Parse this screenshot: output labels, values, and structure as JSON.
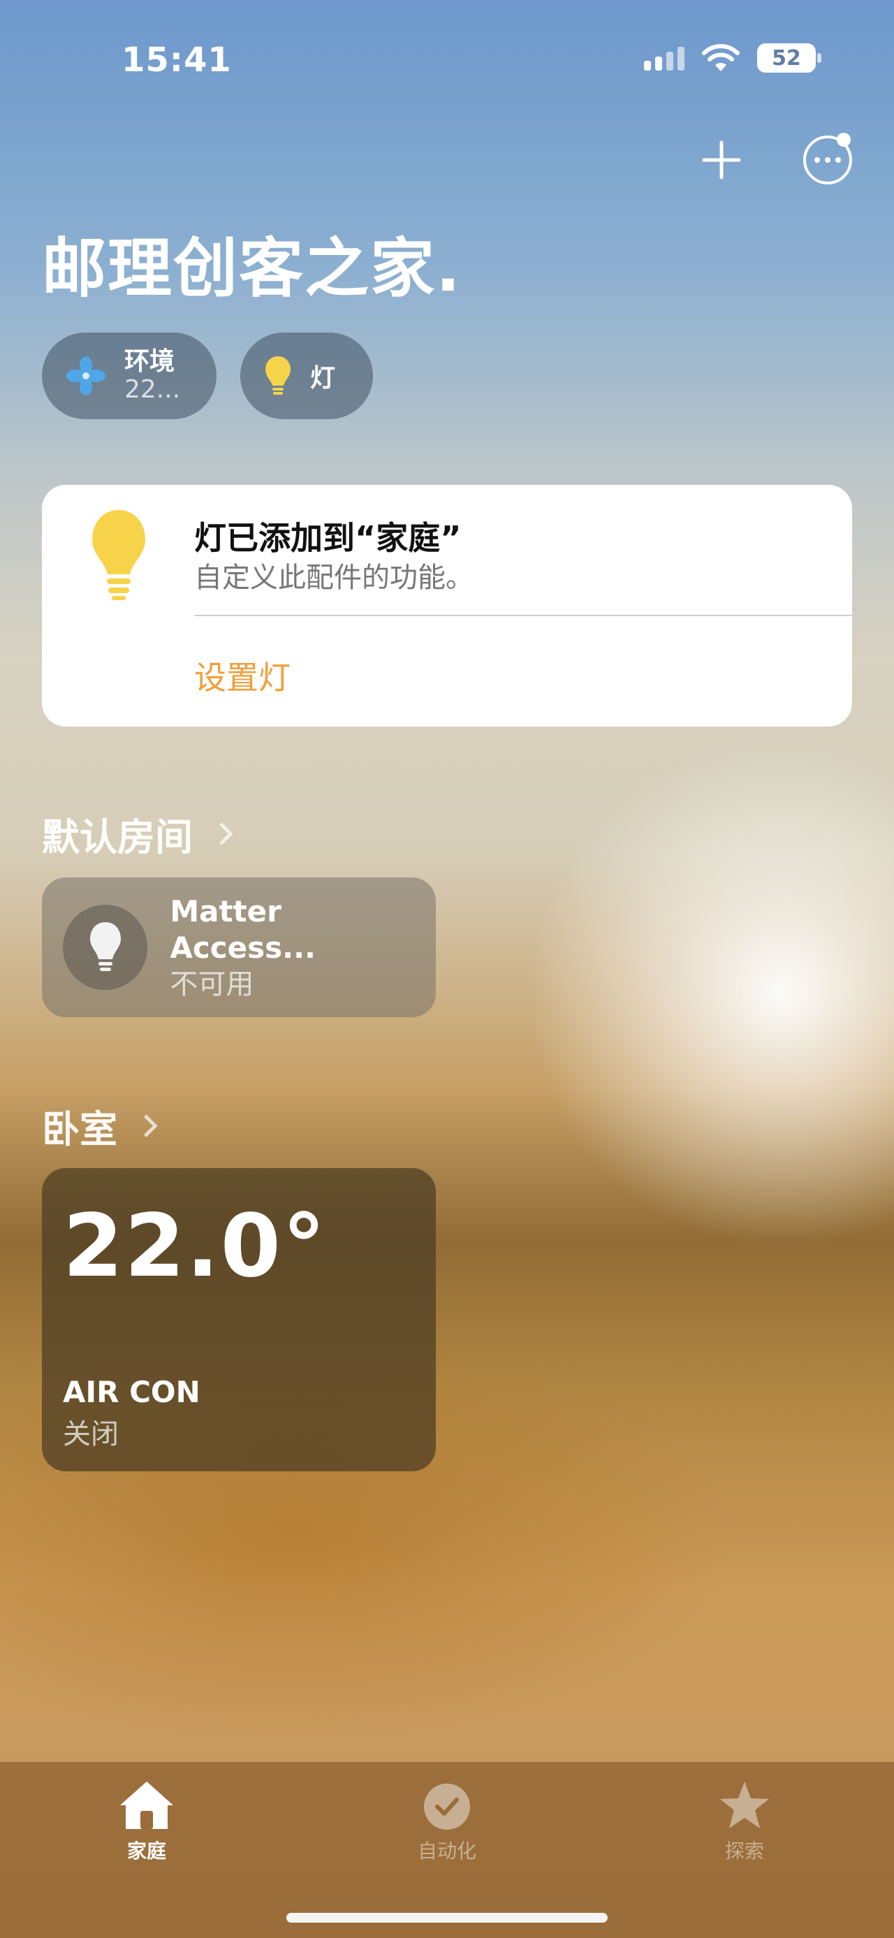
{
  "status_bar": {
    "time": "15:41",
    "battery": "52"
  },
  "header": {
    "home_name": "邮理创客之家."
  },
  "chips": [
    {
      "title": "环境",
      "subtitle": "22..."
    },
    {
      "title": "灯"
    }
  ],
  "notification": {
    "title": "灯已添加到“家庭”",
    "subtitle": "自定义此配件的功能。",
    "action": "设置灯"
  },
  "rooms": [
    {
      "name": "默认房间",
      "accessory": {
        "name": "Matter Access...",
        "status": "不可用"
      }
    },
    {
      "name": "卧室",
      "climate": {
        "temperature": "22.0°",
        "name": "AIR CON",
        "status": "关闭"
      }
    }
  ],
  "tabbar": {
    "tabs": [
      {
        "label": "家庭",
        "icon": "house-icon",
        "active": true
      },
      {
        "label": "自动化",
        "icon": "clock-check-icon",
        "active": false
      },
      {
        "label": "探索",
        "icon": "star-icon",
        "active": false
      }
    ]
  },
  "colors": {
    "accent_orange": "#f0a03a",
    "bulb_yellow": "#f7d34a",
    "fan_blue": "#4fa6e8"
  }
}
